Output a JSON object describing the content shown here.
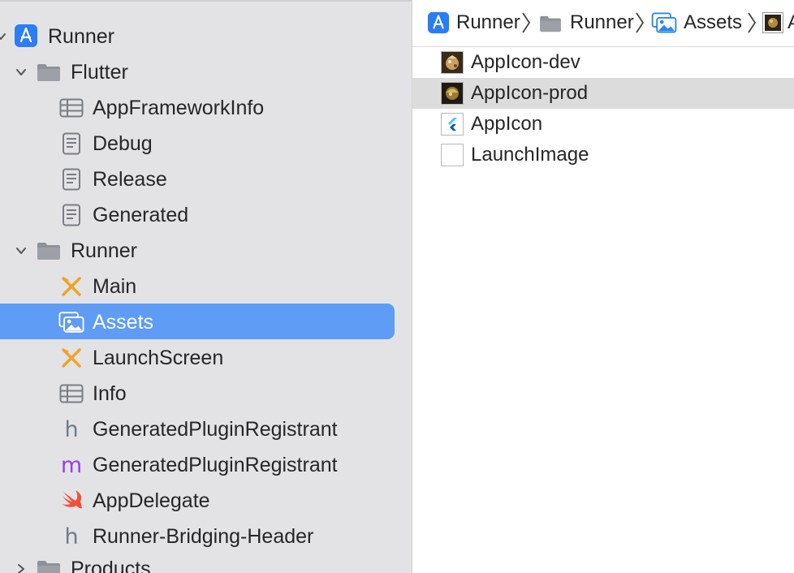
{
  "navigator": {
    "project": {
      "label": "Runner",
      "icon": "xcode-app-icon"
    },
    "items": [
      {
        "label": "Flutter",
        "icon": "folder-icon",
        "disclosure": "chevron-down-icon"
      },
      {
        "label": "AppFrameworkInfo",
        "icon": "plist-icon"
      },
      {
        "label": "Debug",
        "icon": "xcconfig-file-icon"
      },
      {
        "label": "Release",
        "icon": "xcconfig-file-icon"
      },
      {
        "label": "Generated",
        "icon": "xcconfig-file-icon"
      },
      {
        "label": "Runner",
        "icon": "folder-icon",
        "disclosure": "chevron-down-icon"
      },
      {
        "label": "Main",
        "icon": "storyboard-icon"
      },
      {
        "label": "Assets",
        "icon": "asset-catalog-icon",
        "selected": true
      },
      {
        "label": "LaunchScreen",
        "icon": "storyboard-icon"
      },
      {
        "label": "Info",
        "icon": "plist-icon"
      },
      {
        "label": "GeneratedPluginRegistrant",
        "icon": "header-file-icon",
        "glyph": "h"
      },
      {
        "label": "GeneratedPluginRegistrant",
        "icon": "objc-file-icon",
        "glyph": "m"
      },
      {
        "label": "AppDelegate",
        "icon": "swift-icon"
      },
      {
        "label": "Runner-Bridging-Header",
        "icon": "header-file-icon",
        "glyph": "h"
      },
      {
        "label": "Products",
        "icon": "folder-icon",
        "disclosure": "chevron-right-icon"
      }
    ]
  },
  "jumpbar": {
    "crumbs": [
      {
        "label": "Runner",
        "icon": "xcode-app-icon"
      },
      {
        "label": "Runner",
        "icon": "folder-icon"
      },
      {
        "label": "Assets",
        "icon": "asset-catalog-icon"
      },
      {
        "label": "A",
        "icon": "app-icon-thumbnail"
      }
    ]
  },
  "assets": [
    {
      "label": "AppIcon-dev",
      "icon": "app-icon-dev-thumbnail"
    },
    {
      "label": "AppIcon-prod",
      "icon": "app-icon-prod-thumbnail",
      "highlighted": true
    },
    {
      "label": "AppIcon",
      "icon": "flutter-icon"
    },
    {
      "label": "LaunchImage",
      "icon": "blank-image-icon"
    }
  ],
  "colors": {
    "accent": "#5e9cf5",
    "sidebar_bg": "#e3e3e6",
    "folder": "#8e9197",
    "storyboard": "#f0a32a",
    "objc_m": "#9b3ee0",
    "swift": "#f05138"
  }
}
